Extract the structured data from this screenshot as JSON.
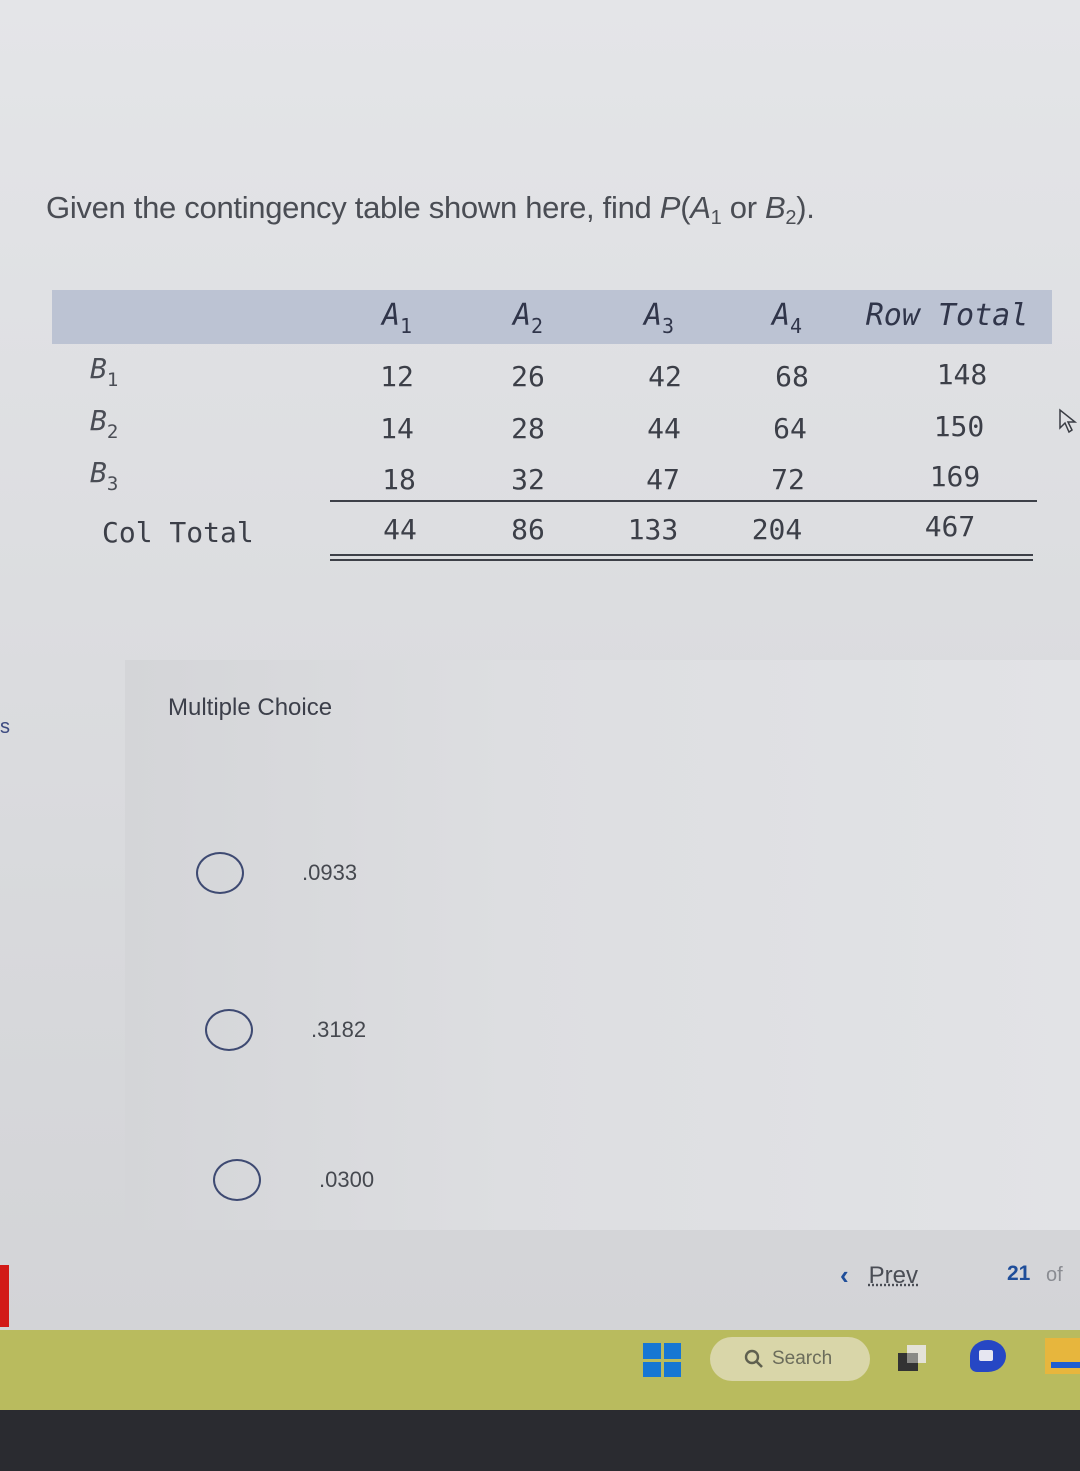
{
  "question": {
    "prefix": "Given the contingency table shown here, find ",
    "prob_symbol": "P",
    "event1": "A",
    "event1_sub": "1",
    "connector": " or ",
    "event2": "B",
    "event2_sub": "2",
    "suffix": ")."
  },
  "table": {
    "columns": [
      {
        "base": "A",
        "sub": "1"
      },
      {
        "base": "A",
        "sub": "2"
      },
      {
        "base": "A",
        "sub": "3"
      },
      {
        "base": "A",
        "sub": "4"
      }
    ],
    "row_total_header": "Row Total",
    "rows": [
      {
        "base": "B",
        "sub": "1",
        "values": [
          "12",
          "26",
          "42",
          "68"
        ],
        "total": "148"
      },
      {
        "base": "B",
        "sub": "2",
        "values": [
          "14",
          "28",
          "44",
          "64"
        ],
        "total": "150"
      },
      {
        "base": "B",
        "sub": "3",
        "values": [
          "18",
          "32",
          "47",
          "72"
        ],
        "total": "169"
      }
    ],
    "col_total_label": "Col Total",
    "col_totals": [
      "44",
      "86",
      "133",
      "204"
    ],
    "grand_total": "467"
  },
  "multiple_choice": {
    "title": "Multiple Choice",
    "options": [
      ".0933",
      ".3182",
      ".0300"
    ]
  },
  "pager": {
    "prev_label": "Prev",
    "current": "21",
    "of_label": "of"
  },
  "sidebar_fragment": "s",
  "taskbar": {
    "search_label": "Search"
  },
  "colors": {
    "table_header_bg": "#bcc3d3",
    "accent_blue": "#1f4e9a",
    "taskbar": "#b9bb5e",
    "red_tab": "#d21a18"
  }
}
